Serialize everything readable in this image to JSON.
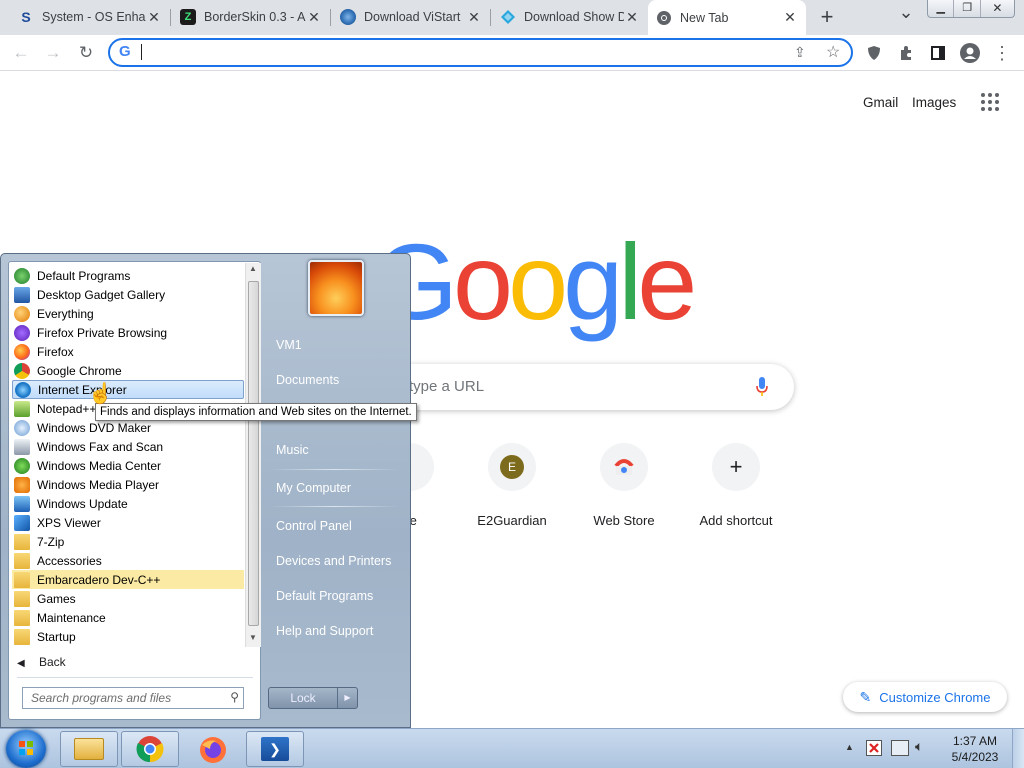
{
  "browser": {
    "tabs": [
      {
        "title": "System - OS Enhancement",
        "favicon": "S"
      },
      {
        "title": "BorderSkin 0.3 - A",
        "favicon": "Z"
      },
      {
        "title": "Download ViStart",
        "favicon": "vistart-icon"
      },
      {
        "title": "Download Show D",
        "favicon": "download-icon"
      },
      {
        "title": "New Tab",
        "favicon": "chrome-icon",
        "active": true
      }
    ],
    "new_tab_symbol": "+",
    "tab_search_symbol": "⌄",
    "omnibox": {
      "value": "",
      "prefix": "G"
    }
  },
  "google_page": {
    "top_links": [
      "Gmail",
      "Images"
    ],
    "logo": [
      "G",
      "o",
      "o",
      "g",
      "l",
      "e"
    ],
    "logo_colors": [
      "#4285f4",
      "#ea4335",
      "#fbbc05",
      "#4285f4",
      "#34a853",
      "#ea4335"
    ],
    "search_placeholder": "type a URL",
    "shortcuts": [
      {
        "label": "ce",
        "initial": ""
      },
      {
        "label": "E2Guardian",
        "initial": "E"
      },
      {
        "label": "Web Store",
        "initial": ""
      },
      {
        "label": "Add shortcut",
        "initial": "+"
      }
    ],
    "customize_label": "Customize Chrome"
  },
  "start_menu": {
    "programs": [
      {
        "label": "Default Programs",
        "icon": "default-programs-icon"
      },
      {
        "label": "Desktop Gadget Gallery",
        "icon": "gadget-icon"
      },
      {
        "label": "Everything",
        "icon": "everything-icon"
      },
      {
        "label": "Firefox Private Browsing",
        "icon": "firefox-private-icon"
      },
      {
        "label": "Firefox",
        "icon": "firefox-icon"
      },
      {
        "label": "Google Chrome",
        "icon": "chrome-icon"
      },
      {
        "label": "Internet Explorer",
        "icon": "ie-icon",
        "highlighted": true
      },
      {
        "label": "Notepad++",
        "icon": "notepadpp-icon"
      },
      {
        "label": "Windows DVD Maker",
        "icon": "dvd-maker-icon"
      },
      {
        "label": "Windows Fax and Scan",
        "icon": "fax-icon"
      },
      {
        "label": "Windows Media Center",
        "icon": "media-center-icon"
      },
      {
        "label": "Windows Media Player",
        "icon": "media-player-icon"
      },
      {
        "label": "Windows Update",
        "icon": "windows-update-icon"
      },
      {
        "label": "XPS Viewer",
        "icon": "xps-icon"
      },
      {
        "label": "7-Zip",
        "icon": "folder-icon"
      },
      {
        "label": "Accessories",
        "icon": "folder-icon"
      },
      {
        "label": "Embarcadero Dev-C++",
        "icon": "folder-icon",
        "folder_highlight": true
      },
      {
        "label": "Games",
        "icon": "folder-icon"
      },
      {
        "label": "Maintenance",
        "icon": "folder-icon"
      },
      {
        "label": "Startup",
        "icon": "folder-icon"
      }
    ],
    "back_label": "Back",
    "search_placeholder": "Search programs and files",
    "tooltip": "Finds and displays information and Web sites on the Internet.",
    "right_items": [
      "VM1",
      "Documents",
      "Music",
      "My Computer",
      "Control Panel",
      "Devices and Printers",
      "Default Programs",
      "Help and Support"
    ],
    "lock_label": "Lock"
  },
  "taskbar": {
    "time": "1:37 AM",
    "date": "5/4/2023"
  }
}
